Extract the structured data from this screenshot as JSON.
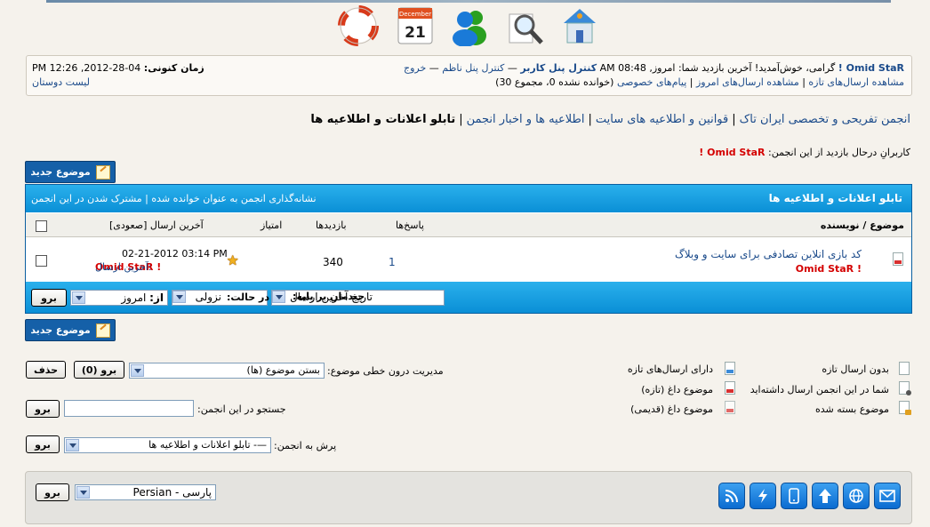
{
  "top_icons": [
    "lifebuoy-icon",
    "calendar-icon",
    "members-icon",
    "search-icon",
    "home-icon"
  ],
  "calendar": {
    "month": "December",
    "day": "21"
  },
  "info": {
    "welcome_name": "Omid StaR !",
    "welcome_text": "گرامی، خوش‌آمدید! آخرین بازدید شما: امروز, 08:48 AM",
    "control_panel": "کنترل پنل کاربر",
    "admin_panel": "کنترل پنل ناظم",
    "logout": "خروج",
    "dash": "—",
    "new_posts": "مشاهده ارسال‌های تازه",
    "today_posts": "مشاهده ارسال‌های امروز",
    "pm": "پیام‌های خصوصی",
    "pm_count": "(خوانده نشده 0، مجموع 30)",
    "time_label": "زمان کنونی:",
    "time_value": "04-28-2012, 12:26 PM",
    "friends": "لیست دوستان"
  },
  "breadcrumb": {
    "items": [
      "انجمن تفریحی و تخصصی ایران تاک",
      "قوانین و اطلاعیه های سایت",
      "اطلاعیه ها و اخبار انجمن"
    ],
    "current": "تابلو اعلانات و اطلاعیه ها",
    "sep": "|"
  },
  "viewers": {
    "label": "کاربرانِ درحال بازدید از این انجمن:",
    "names": "Omid StaR !"
  },
  "new_topic": "موضوع جدید",
  "forum": {
    "title": "تابلو اعلانات و اطلاعیه ها",
    "options": "نشانه‌گذاری انجمن به عنوان خوانده شده | مشترک شدن در این انجمن",
    "columns": {
      "topic": "موضوع / نویسنده",
      "replies": "پاسخ‌ها",
      "views": "بازدیدها",
      "rating": "امتیاز",
      "last_post": "آخرین ارسال [صعودی]"
    },
    "rows": [
      {
        "title": "کد بازی انلاین تصادفی برای سایت و وبلاگ",
        "author": "Omid StaR !",
        "replies": "1",
        "views": "340",
        "rating": 5,
        "last_date": "02-21-2012 03:14 PM",
        "last_by_label": "آخرین ارسال:",
        "last_by": "Omid StaR !"
      }
    ],
    "footer": {
      "sort_label": "چیدمان بر پایه:",
      "sort_value": "تاریخ آخرین ارسال",
      "order_label": "در حالت:",
      "order_value": "نزولی",
      "from_label": "از:",
      "from_value": "امروز",
      "go": "برو"
    }
  },
  "legend": {
    "col1": [
      "بدون ارسال تازه",
      "شما در این انجمن ارسال داشته‌اید",
      "موضوع بسته شده"
    ],
    "col2": [
      "دارای ارسال‌های تازه",
      "موضوع داغ (تازه)",
      "موضوع داغ (قدیمی)"
    ]
  },
  "moderation": {
    "label": "مدیریت درون خطی موضوع:",
    "value": "بستن موضوع (ها)",
    "go": "برو (0)",
    "delete": "حذف"
  },
  "search_forum": {
    "label": "جستجو در این انجمن:",
    "go": "برو"
  },
  "jump": {
    "label": "پرش به انجمن:",
    "value": "—- تابلو اعلانات و اطلاعیه ها",
    "go": "برو"
  },
  "language": {
    "value": "پارسی - Persian",
    "go": "برو"
  },
  "bottom_icons": [
    "email-icon",
    "globe-icon",
    "arrow-up-icon",
    "mobile-icon",
    "lightning-icon",
    "rss-icon"
  ]
}
